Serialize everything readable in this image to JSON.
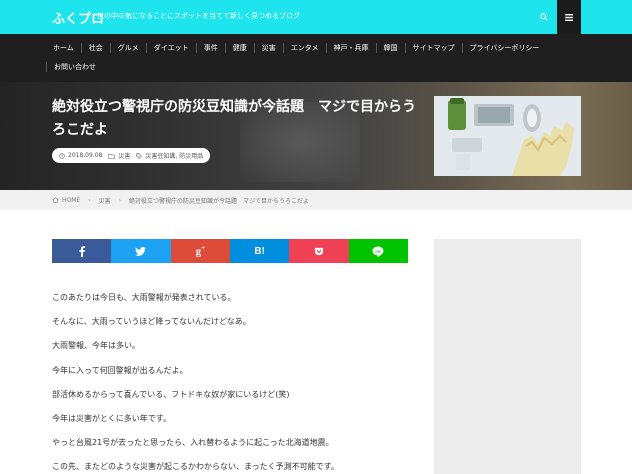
{
  "header": {
    "site_title": "ふくプロ",
    "site_description": "世の中の気になることにスポットを当てて新しく見つめるブログ"
  },
  "nav": {
    "row1": [
      "ホーム",
      "社会",
      "グルメ",
      "ダイエット",
      "事件",
      "健康",
      "災害",
      "エンタメ",
      "神戸・兵庫",
      "韓国",
      "サイトマップ",
      "プライバシーポリシー"
    ],
    "row2": [
      "お問い合わせ"
    ]
  },
  "article": {
    "title": "絶対役立つ警視庁の防災豆知識が今話題　マジで目からうろこだよ",
    "date": "2018.09.08",
    "category": "災害",
    "tags": "災害豆知識, 防災用品"
  },
  "breadcrumb": {
    "home": "HOME",
    "category": "災害",
    "current": "絶対役立つ警視庁の防災豆知識が今話題　マジで目からうろこだよ"
  },
  "share": {
    "buttons": [
      {
        "service": "facebook",
        "glyph": "f",
        "color": "#3b5a9a"
      },
      {
        "service": "twitter",
        "glyph": "🐦",
        "color": "#1da1f2"
      },
      {
        "service": "google-plus",
        "glyph": "g+",
        "color": "#dd4b39"
      },
      {
        "service": "hatena",
        "glyph": "B!",
        "color": "#008fde"
      },
      {
        "service": "pocket",
        "glyph": "pocket",
        "color": "#ef4056"
      },
      {
        "service": "line",
        "glyph": "LINE",
        "color": "#00c300"
      }
    ]
  },
  "content": {
    "paragraphs": [
      "このあたりは今日も、大雨警報が発表されている。",
      "そんなに、大雨っていうほど降ってないんだけどなあ。",
      "大雨警報、今年は多い。",
      "今年に入って何回警報が出るんだよ。",
      "部活休めるからって喜んでいる、フトドキな奴が家にいるけど(笑)",
      "今年は災害がとくに多い年です。",
      "やっと台風21号が去ったと思ったら、入れ替わるように起こった北海道地震。",
      "この先、またどのような災害が起こるかわからない、まったく予測不可能です。"
    ]
  }
}
